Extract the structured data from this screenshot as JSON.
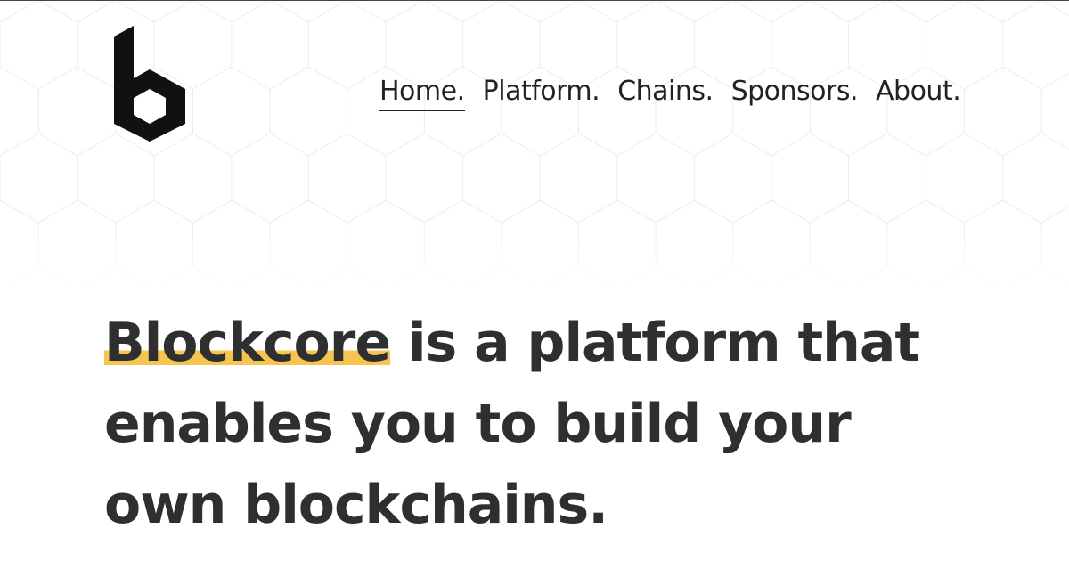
{
  "nav": {
    "items": [
      {
        "label": "Home.",
        "active": true
      },
      {
        "label": "Platform.",
        "active": false
      },
      {
        "label": "Chains.",
        "active": false
      },
      {
        "label": "Sponsors.",
        "active": false
      },
      {
        "label": "About.",
        "active": false
      }
    ]
  },
  "hero": {
    "highlight": "Blockcore",
    "line1_rest": " is a platform that",
    "line2": "enables you to build your",
    "line3": "own blockchains."
  },
  "colors": {
    "text": "#2f2f2f",
    "highlight": "#f7c44f",
    "logo": "#111111"
  }
}
